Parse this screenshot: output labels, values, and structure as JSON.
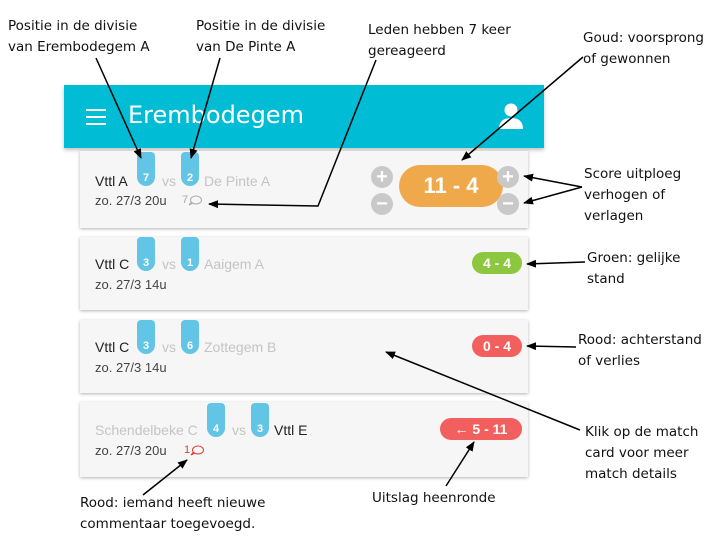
{
  "annotations": {
    "pos_home_l1": "Positie in de divisie",
    "pos_home_l2": "van Erembodegem A",
    "pos_away_l1": "Positie in de divisie",
    "pos_away_l2": "van De Pinte A",
    "comments_l1": "Leden hebben 7 keer",
    "comments_l2": "gereageerd",
    "gold_l1": "Goud: voorsprong",
    "gold_l2": "of gewonnen",
    "score_l1": "Score uitploeg",
    "score_l2": "verhogen of",
    "score_l3": "verlagen",
    "green_l1": "Groen: gelijke",
    "green_l2": "stand",
    "red_l1": "Rood: achterstand",
    "red_l2": "of verlies",
    "click_l1": "Klik op de match",
    "click_l2": "card voor meer",
    "click_l3": "match details",
    "newc_l1": "Rood: iemand heeft nieuwe",
    "newc_l2": "commentaar toegevoegd.",
    "result_l1": "Uitslag heenronde"
  },
  "appbar": {
    "title": "Erembodegem",
    "color": "#00bcd4",
    "menu_icon": "hamburger-icon",
    "user_icon": "user-icon"
  },
  "colors": {
    "gold": "#f0a94a",
    "green": "#8dc63f",
    "red": "#f1605e",
    "position": "#63c5e6"
  },
  "matches": [
    {
      "home": "Vttl A",
      "home_pos": "7",
      "vs": "vs",
      "away": "De Pinte A",
      "away_pos": "2",
      "date": "zo. 27/3 20u",
      "comments": "7",
      "score": "11 - 4",
      "plus": "+",
      "minus": "−"
    },
    {
      "home": "Vttl C",
      "home_pos": "3",
      "vs": "vs",
      "away": "Aaigem A",
      "away_pos": "1",
      "date": "zo. 27/3 14u",
      "score": "4 - 4"
    },
    {
      "home": "Vttl C",
      "home_pos": "3",
      "vs": "vs",
      "away": "Zottegem B",
      "away_pos": "6",
      "date": "zo. 27/3 14u",
      "score": "0 - 4"
    },
    {
      "home": "Schendelbeke C",
      "home_pos": "4",
      "vs": "vs",
      "away": "Vttl E",
      "away_pos": "3",
      "date": "zo. 27/3 20u",
      "comments": "1",
      "score": "← 5 - 11"
    }
  ]
}
